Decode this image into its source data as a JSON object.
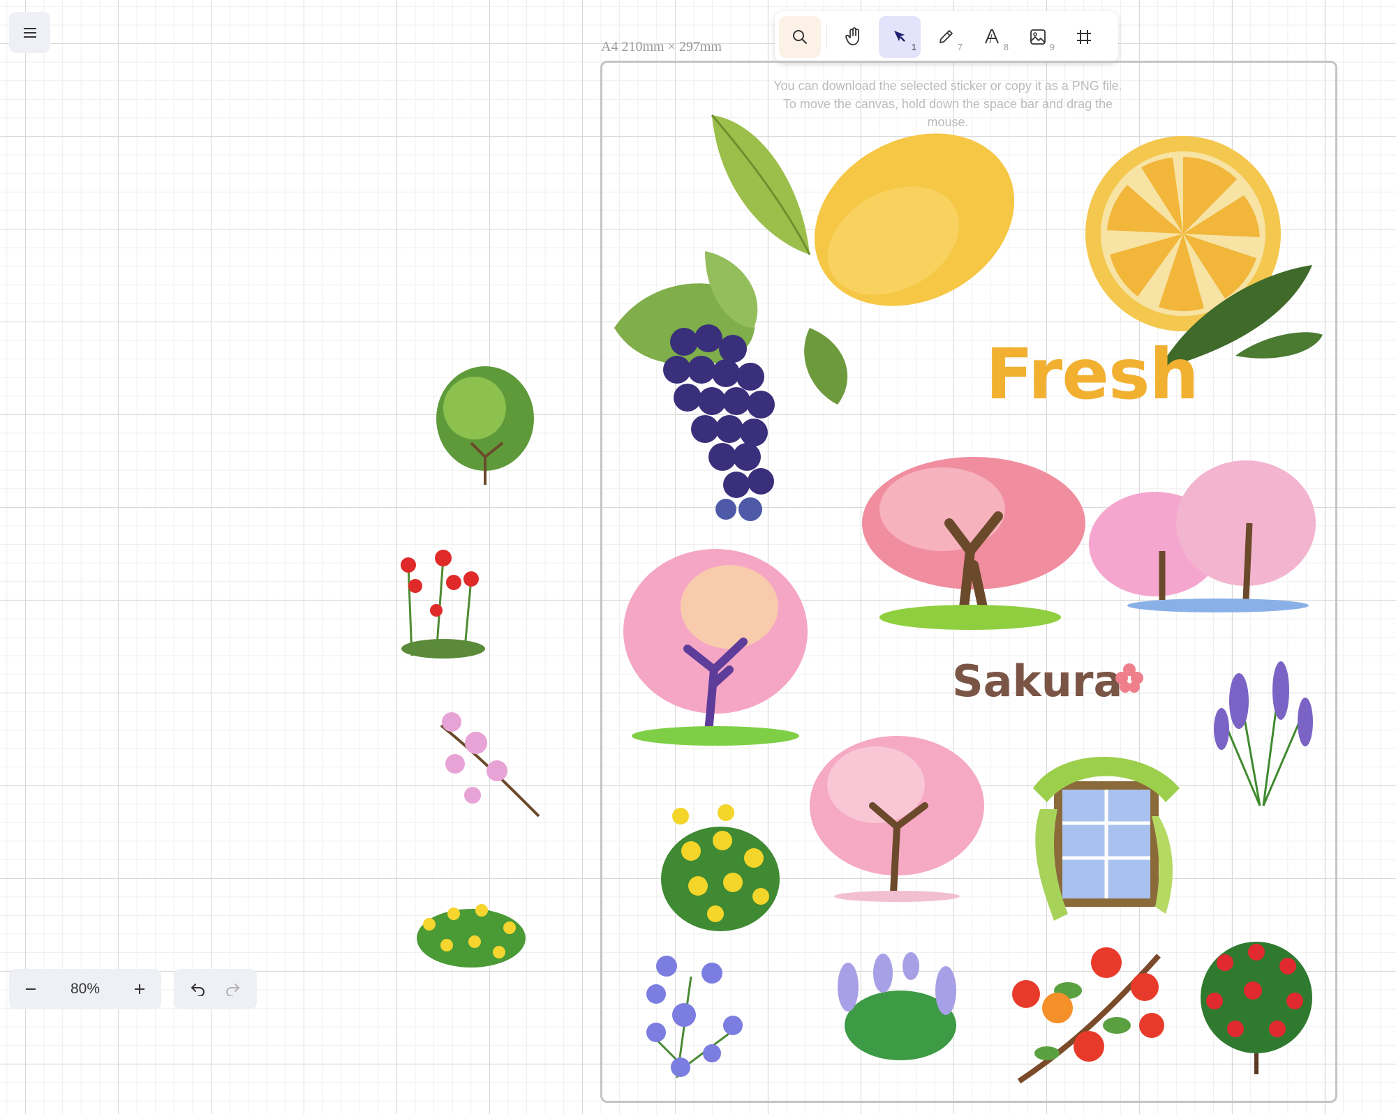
{
  "menu": {
    "icon": "hamburger-icon"
  },
  "toolbar": {
    "tools": [
      {
        "name": "search",
        "icon": "search-icon"
      },
      {
        "name": "hand",
        "icon": "hand-icon"
      },
      {
        "name": "select",
        "icon": "pointer-icon",
        "key": "1",
        "active": true
      },
      {
        "name": "pen",
        "icon": "pencil-icon",
        "key": "7"
      },
      {
        "name": "text",
        "icon": "text-icon",
        "key": "8"
      },
      {
        "name": "image",
        "icon": "image-icon",
        "key": "9"
      },
      {
        "name": "frame",
        "icon": "frame-icon"
      }
    ]
  },
  "paper": {
    "label": "A4 210mm × 297mm",
    "hint": "You can download the selected sticker or copy it as a PNG file. To move the canvas, hold down the space bar and drag the mouse."
  },
  "stickers": {
    "fresh_text": "Fresh",
    "sakura_text": "Sakura"
  },
  "zoom": {
    "value": "80%",
    "minus_icon": "minus-icon",
    "plus_icon": "plus-icon"
  },
  "history": {
    "undo_icon": "undo-icon",
    "redo_icon": "redo-icon"
  },
  "colors": {
    "accent": "#e3e3fb",
    "search_bg": "#fbf1e6",
    "fresh": "#f2b031",
    "sakura": "#7a5545"
  }
}
